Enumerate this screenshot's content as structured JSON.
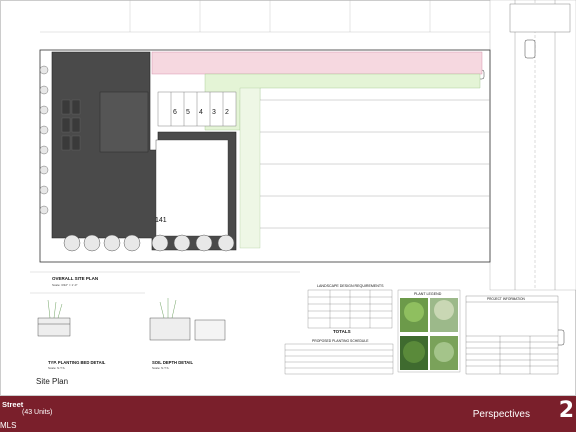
{
  "sheet": {
    "overall_site_plan_label": "OVERALL SITE PLAN",
    "overall_site_plan_scale": "Scale: 3/32\" = 1'-0\"",
    "planting_bed_label": "TYP. PLANTING BED DETAIL",
    "planting_bed_scale": "Scale: N.T.S.",
    "soil_depth_label": "SOIL DEPTH DETAIL",
    "soil_depth_scale": "Scale: N.T.S.",
    "landscape_table_title": "LANDSCAPE DESIGN REQUIREMENTS",
    "planting_schedule_title": "PROPOSED PLANTING SCHEDULE",
    "plant_legend_title": "PLANT LEGEND",
    "project_info_title": "PROJECT INFORMATION",
    "totals_label": "TOTALS",
    "unit_numbers": [
      "6",
      "5",
      "4",
      "3",
      "2"
    ],
    "building_number": "141",
    "site_plan_caption": "Site Plan"
  },
  "footer": {
    "street": "Street",
    "units": "(43 Units)",
    "mls": "MLS",
    "title": "Perspectives",
    "logo_glyph": "2"
  },
  "colors": {
    "footer_bg": "#7a1f2b",
    "building_fill": "#4a4a4a",
    "access_strip": "#f6d8e0",
    "parking_green": "#d9f0c8"
  }
}
